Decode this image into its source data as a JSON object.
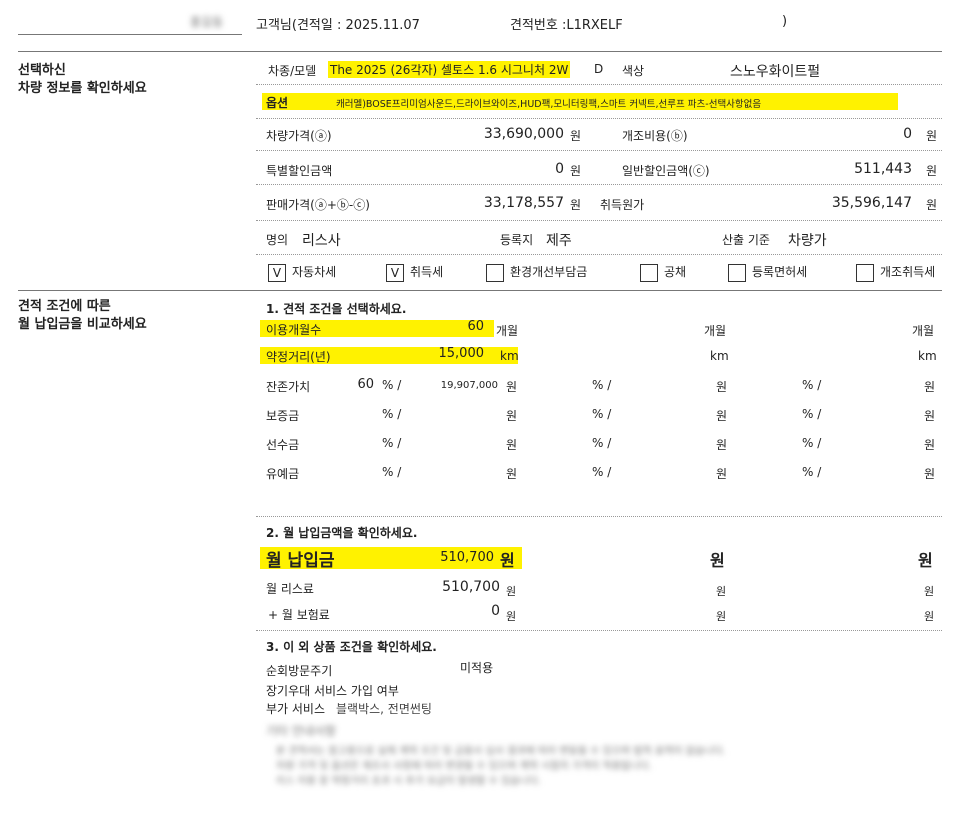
{
  "header": {
    "customer_name": "홍길동",
    "customer_suffix": "고객님(견적일 : 2025.11.07",
    "quote_no": "견적번호 :L1RXELF",
    "close_paren": ")"
  },
  "vehicle_section": {
    "title_line1": "선택하신",
    "title_line2": "차량 정보를 확인하세요",
    "model_label": "차종/모델",
    "model_value": "The 2025 (26각자) 셀토스 1.6 시그니처 2W",
    "model_tail": "D",
    "color_label": "색상",
    "color_value": "스노우화이트펄",
    "options_label": "옵션",
    "options_value": "캐러멜)BOSE프리미엄사운드,드라이브와이즈,HUD팩,모니터링팩,스마트 커넥트,선루프 파츠-선택사항없음",
    "price_label": "차량가격(ⓐ)",
    "price_value": "33,690,000",
    "mod_label": "개조비용(ⓑ)",
    "mod_value": "0",
    "special_disc_label": "특별할인금액",
    "special_disc_value": "0",
    "general_disc_label": "일반할인금액(ⓒ)",
    "general_disc_value": "511,443",
    "sale_label": "판매가격(ⓐ+ⓑ-ⓒ)",
    "sale_value": "33,178,557",
    "acq_label": "취득원가",
    "acq_value": "35,596,147",
    "won": "원",
    "owner_label": "명의",
    "owner_value": "리스사",
    "reg_label": "등록지",
    "reg_value": "제주",
    "basis_label": "산출 기준",
    "basis_value": "차량가",
    "checks": [
      {
        "label": "자동차세",
        "mark": "V"
      },
      {
        "label": "취득세",
        "mark": "V"
      },
      {
        "label": "환경개선부담금",
        "mark": ""
      },
      {
        "label": "공채",
        "mark": ""
      },
      {
        "label": "등록면허세",
        "mark": ""
      },
      {
        "label": "개조취득세",
        "mark": ""
      }
    ]
  },
  "compare_section": {
    "title_line1": "견적 조건에 따른",
    "title_line2": "월 납입금을 비교하세요",
    "step1": "1. 견적 조건을 선택하세요.",
    "term_label": "이용개월수",
    "term_value": "60",
    "month_unit": "개월",
    "mileage_label": "약정거리(년)",
    "mileage_value": "15,000",
    "km_unit": "km",
    "residual_label": "잔존가치",
    "residual_pct": "60",
    "residual_amount": "19,907,000",
    "deposit_label": "보증금",
    "prepay_label": "선수금",
    "grace_label": "유예금",
    "pct_unit": "% /",
    "won": "원",
    "step2": "2. 월 납입금액을 확인하세요.",
    "monthly_label": "월 납입금",
    "monthly_value": "510,700",
    "lease_label": "월 리스료",
    "lease_value": "510,700",
    "insurance_label": "+ 월 보험료",
    "insurance_value": "0"
  },
  "other_section": {
    "step3": "3. 이 외 상품 조건을 확인하세요.",
    "visit_label": "순회방문주기",
    "visit_value": "미적용",
    "longterm_label": "장기우대 서비스 가입 여부",
    "addon_label": "부가 서비스",
    "addon_value": "블랙박스, 전면썬팅",
    "notes_title": "기타 안내사항",
    "notes_lines": [
      "본 견적서는 참고용으로 실제 계약 조건 및 금융사 심사 결과에 따라 변동될 수 있으며 법적 효력이 없습니다.",
      "차량 가격 및 옵션은 제조사 사정에 따라 변경될 수 있으며 계약 시점의 가격이 적용됩니다.",
      "리스 이용 중 약정거리 초과 시 추가 요금이 발생할 수 있습니다."
    ]
  }
}
